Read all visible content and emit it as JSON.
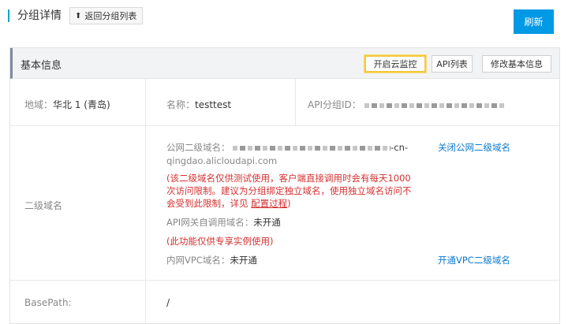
{
  "header": {
    "title": "分组详情",
    "back_label": "返回分组列表",
    "refresh_label": "刷新"
  },
  "section": {
    "title": "基本信息",
    "buttons": {
      "open_cloud_monitor": "开启云监控",
      "api_list": "API列表",
      "edit_basic_info": "修改基本信息"
    }
  },
  "region": {
    "label": "地域：",
    "value": "华北 1 (青岛)"
  },
  "name": {
    "label": "名称：",
    "value": "testtest"
  },
  "group_id": {
    "label": "API分组ID："
  },
  "subdomain": {
    "label": "二级域名",
    "public_label": "公网二级域名：",
    "public_suffix": "-cn-",
    "public_value_line2": "qingdao.alicloudapi.com",
    "close_link": "关闭公网二级域名",
    "notice_line1": "(该二级域名仅供测试使用，客户端直接调用时会有每天1000",
    "notice_line2": "次访问限制。建议为分组绑定独立域名，使用独立域名访问不",
    "notice_line3_prefix": "会受到此限制，详见 ",
    "notice_link": "配置过程",
    "notice_line3_suffix": ")",
    "gateway_label": "API网关自调用域名：",
    "gateway_value": "未开通",
    "exclusive_note": "(此功能仅供专享实例使用)",
    "vpc_label": "内网VPC域名：",
    "vpc_value": "未开通",
    "vpc_link": "开通VPC二级域名"
  },
  "basepath": {
    "label": "BasePath:",
    "value": "/"
  }
}
